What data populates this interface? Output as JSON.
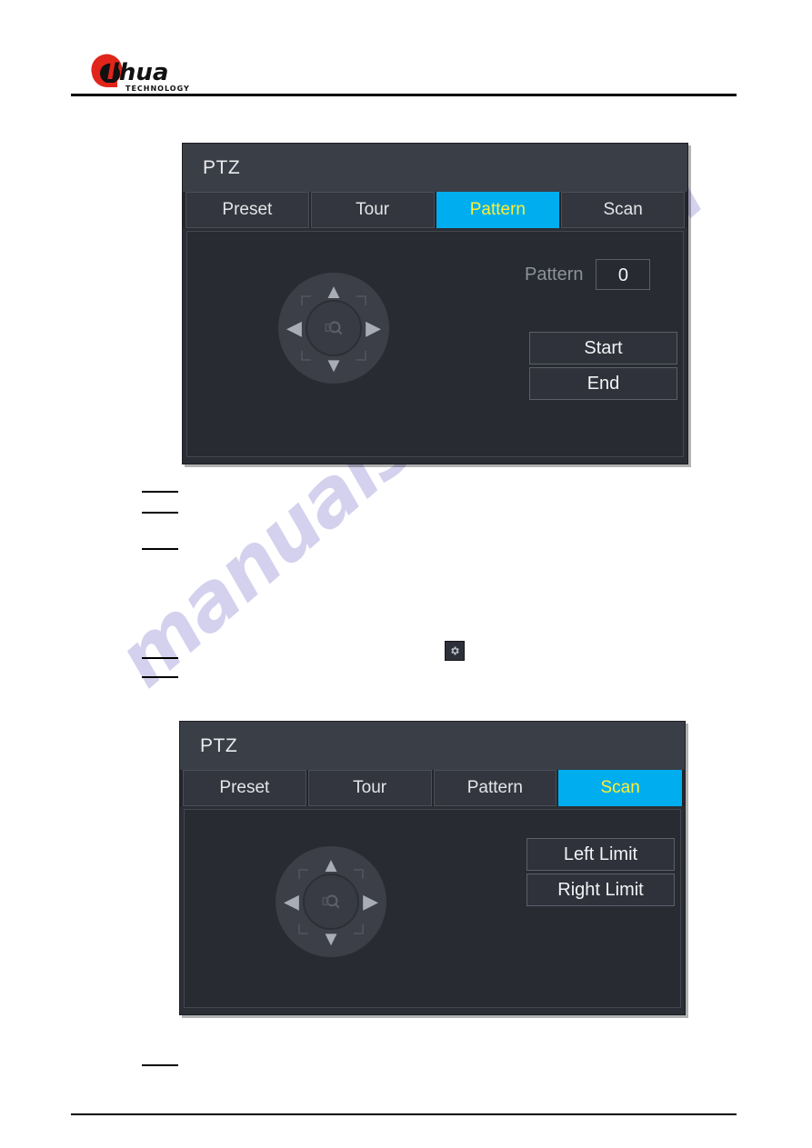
{
  "brand": {
    "name": "alhua",
    "tagline": "TECHNOLOGY"
  },
  "watermark": {
    "text": "manualshive.com"
  },
  "icons": {
    "gear": "gear-icon",
    "magnifier": "magnifier-icon",
    "arrow_up": "▲",
    "arrow_down": "▼",
    "arrow_left": "◀",
    "arrow_right": "▶"
  },
  "colors": {
    "accent": "#00aeef",
    "accent_text": "#ffee33",
    "dialog_bg": "#2b2e35",
    "titlebar_bg": "#3a3e47",
    "body_bg": "#282b32"
  },
  "dialog_pattern": {
    "title": "PTZ",
    "tabs": [
      {
        "label": "Preset",
        "active": false
      },
      {
        "label": "Tour",
        "active": false
      },
      {
        "label": "Pattern",
        "active": true
      },
      {
        "label": "Scan",
        "active": false
      }
    ],
    "field": {
      "label": "Pattern",
      "value": "0"
    },
    "buttons": [
      {
        "label": "Start"
      },
      {
        "label": "End"
      }
    ]
  },
  "dialog_scan": {
    "title": "PTZ",
    "tabs": [
      {
        "label": "Preset",
        "active": false
      },
      {
        "label": "Tour",
        "active": false
      },
      {
        "label": "Pattern",
        "active": false
      },
      {
        "label": "Scan",
        "active": true
      }
    ],
    "buttons": [
      {
        "label": "Left Limit"
      },
      {
        "label": "Right Limit"
      }
    ]
  }
}
